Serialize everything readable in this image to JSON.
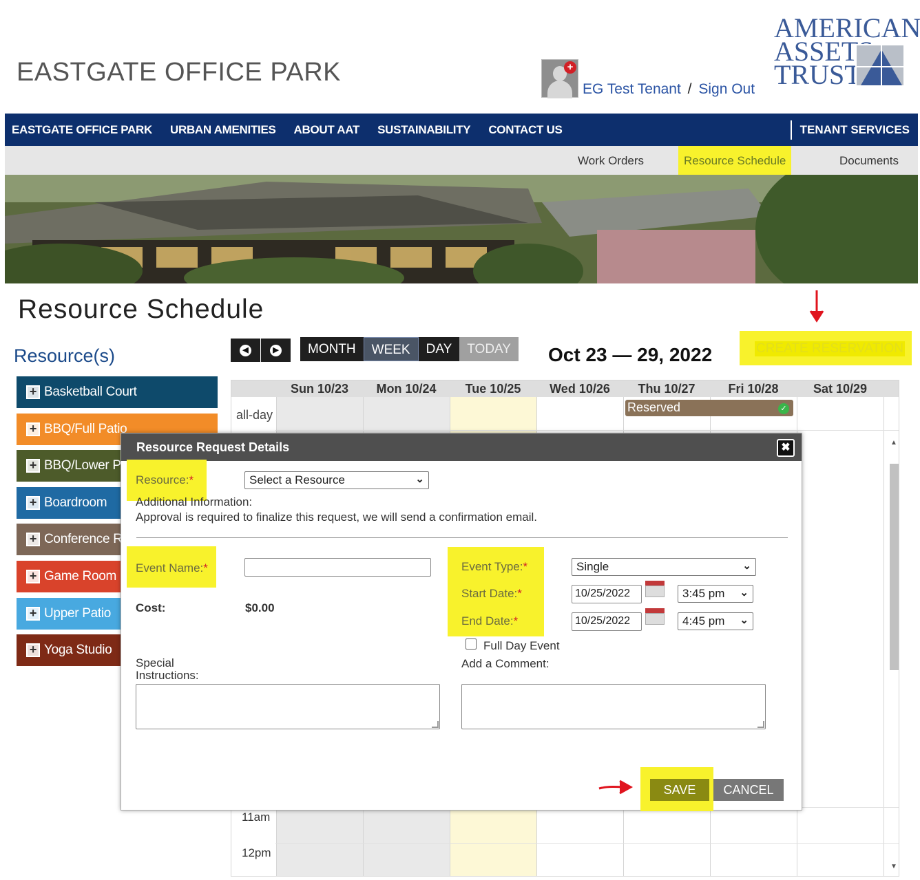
{
  "header": {
    "site_title": "EASTGATE OFFICE PARK",
    "user_name": "EG Test Tenant",
    "separator": "/",
    "sign_out": "Sign Out",
    "logo_lines": [
      "AMERICAN",
      "ASSETS",
      "TRUST"
    ]
  },
  "main_nav": {
    "items": [
      "EASTGATE OFFICE PARK",
      "URBAN AMENITIES",
      "ABOUT AAT",
      "SUSTAINABILITY",
      "CONTACT US"
    ],
    "right": "TENANT SERVICES"
  },
  "sub_nav": {
    "items": [
      "Work Orders",
      "Resource Schedule",
      "Documents"
    ]
  },
  "page": {
    "title": "Resource Schedule",
    "resources_label": "Resource(s)",
    "resources": [
      {
        "label": "Basketball Court",
        "color": "#0e4a6b"
      },
      {
        "label": "BBQ/Full Patio",
        "color": "#f28c28"
      },
      {
        "label": "BBQ/Lower Patio",
        "color": "#4d5b2a"
      },
      {
        "label": "Boardroom",
        "color": "#1f6aa3"
      },
      {
        "label": "Conference Room",
        "color": "#7d6757"
      },
      {
        "label": "Game Room",
        "color": "#d9432b"
      },
      {
        "label": "Upper Patio",
        "color": "#48a9e0"
      },
      {
        "label": "Yoga Studio",
        "color": "#7e2a16"
      }
    ]
  },
  "calendar": {
    "prev_icon": "chevron-left-icon",
    "next_icon": "chevron-right-icon",
    "views": [
      "MONTH",
      "WEEK",
      "DAY",
      "TODAY"
    ],
    "active_view": "WEEK",
    "range": "Oct 23 — 29, 2022",
    "create_button": "CREATE RESERVATION",
    "days": [
      "Sun 10/23",
      "Mon 10/24",
      "Tue 10/25",
      "Wed 10/26",
      "Thu 10/27",
      "Fri 10/28",
      "Sat 10/29"
    ],
    "allday_label": "all-day",
    "event_label": "Reserved",
    "times": [
      "11am",
      "12pm"
    ]
  },
  "modal": {
    "title": "Resource Request Details",
    "resource_label": "Resource:",
    "required_mark": "*",
    "resource_select": "Select a Resource",
    "additional_info": "Additional Information:",
    "approval_note": "Approval is required to finalize this request, we will send a confirmation email.",
    "event_name_label": "Event Name:",
    "event_name_value": "",
    "cost_label": "Cost:",
    "cost_value": "$0.00",
    "event_type_label": "Event Type:",
    "event_type_value": "Single",
    "start_date_label": "Start Date:",
    "start_date_value": "10/25/2022",
    "start_time_value": "3:45 pm",
    "end_date_label": "End Date:",
    "end_date_value": "10/25/2022",
    "end_time_value": "4:45 pm",
    "full_day_label": "Full Day Event",
    "full_day_checked": false,
    "add_comment_label": "Add a Comment:",
    "special_instructions_label": "Special Instructions:",
    "save_label": "SAVE",
    "cancel_label": "CANCEL"
  },
  "colors": {
    "nav_bg": "#0d2f6d",
    "highlight": "#f8f22c",
    "annotation_red": "#e0141e"
  }
}
